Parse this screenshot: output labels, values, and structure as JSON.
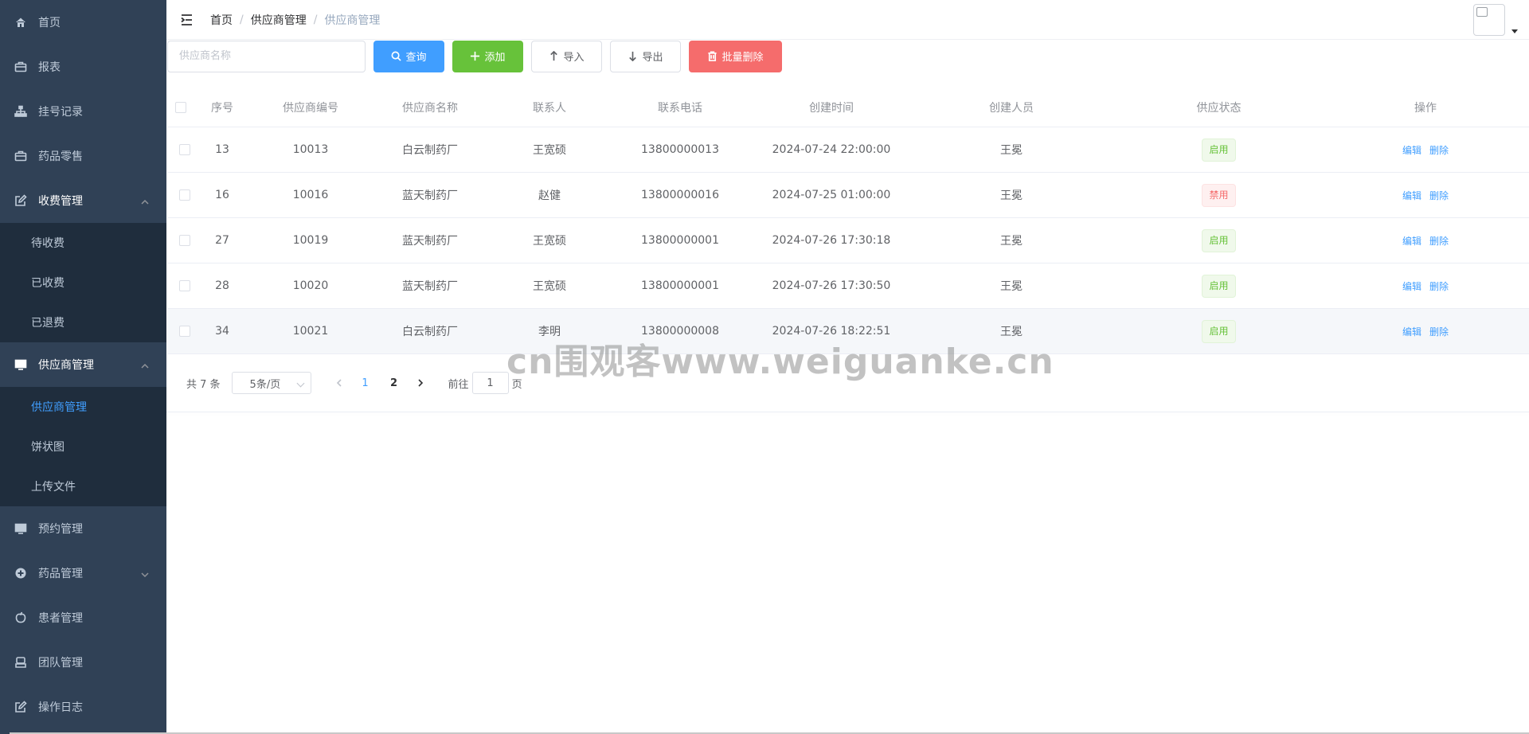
{
  "sidebar": {
    "items": [
      {
        "label": "首页",
        "icon": "home-icon"
      },
      {
        "label": "报表",
        "icon": "briefcase-icon"
      },
      {
        "label": "挂号记录",
        "icon": "tree-icon"
      },
      {
        "label": "药品零售",
        "icon": "briefcase-icon"
      },
      {
        "label": "收费管理",
        "icon": "edit-icon",
        "expanded": true
      },
      {
        "label": "供应商管理",
        "icon": "monitor-icon",
        "expanded": true
      },
      {
        "label": "预约管理",
        "icon": "monitor-icon"
      },
      {
        "label": "药品管理",
        "icon": "plus-circle-icon",
        "expanded": false
      },
      {
        "label": "患者管理",
        "icon": "apple-icon"
      },
      {
        "label": "团队管理",
        "icon": "team-icon"
      },
      {
        "label": "操作日志",
        "icon": "edit-icon"
      }
    ],
    "fee_sub": [
      "待收费",
      "已收费",
      "已退费"
    ],
    "supplier_sub": [
      "供应商管理",
      "饼状图",
      "上传文件"
    ],
    "active_sub": "供应商管理"
  },
  "navbar": {
    "breadcrumb": [
      "首页",
      "供应商管理",
      "供应商管理"
    ],
    "separator": "/"
  },
  "toolbar": {
    "search_placeholder": "供应商名称",
    "query_label": "查询",
    "add_label": "添加",
    "import_label": "导入",
    "export_label": "导出",
    "batch_delete_label": "批量删除"
  },
  "table": {
    "columns": [
      "序号",
      "供应商编号",
      "供应商名称",
      "联系人",
      "联系电话",
      "创建时间",
      "创建人员",
      "供应状态",
      "操作"
    ],
    "rows": [
      {
        "idx": "13",
        "code": "10013",
        "name": "白云制药厂",
        "contact": "王宽硕",
        "phone": "13800000013",
        "time": "2024-07-24 22:00:00",
        "creator": "王冕",
        "status": "启用",
        "enabled": true
      },
      {
        "idx": "16",
        "code": "10016",
        "name": "蓝天制药厂",
        "contact": "赵健",
        "phone": "13800000016",
        "time": "2024-07-25 01:00:00",
        "creator": "王冕",
        "status": "禁用",
        "enabled": false
      },
      {
        "idx": "27",
        "code": "10019",
        "name": "蓝天制药厂",
        "contact": "王宽硕",
        "phone": "13800000001",
        "time": "2024-07-26 17:30:18",
        "creator": "王冕",
        "status": "启用",
        "enabled": true
      },
      {
        "idx": "28",
        "code": "10020",
        "name": "蓝天制药厂",
        "contact": "王宽硕",
        "phone": "13800000001",
        "time": "2024-07-26 17:30:50",
        "creator": "王冕",
        "status": "启用",
        "enabled": true
      },
      {
        "idx": "34",
        "code": "10021",
        "name": "白云制药厂",
        "contact": "李明",
        "phone": "13800000008",
        "time": "2024-07-26 18:22:51",
        "creator": "王冕",
        "status": "启用",
        "enabled": true
      }
    ],
    "edit_label": "编辑",
    "delete_label": "删除"
  },
  "pagination": {
    "total_text": "共 7 条",
    "page_size": "5条/页",
    "pages": [
      "1",
      "2"
    ],
    "current_page": "1",
    "goto_prefix": "前往",
    "goto_value": "1",
    "goto_suffix": "页"
  },
  "watermark": "cn围观客www.weiguanke.cn",
  "colors": {
    "sidebar_bg": "#304156",
    "submenu_bg": "#1f2d3d",
    "primary": "#409eff",
    "success": "#67c23a",
    "danger": "#f56c6c"
  }
}
